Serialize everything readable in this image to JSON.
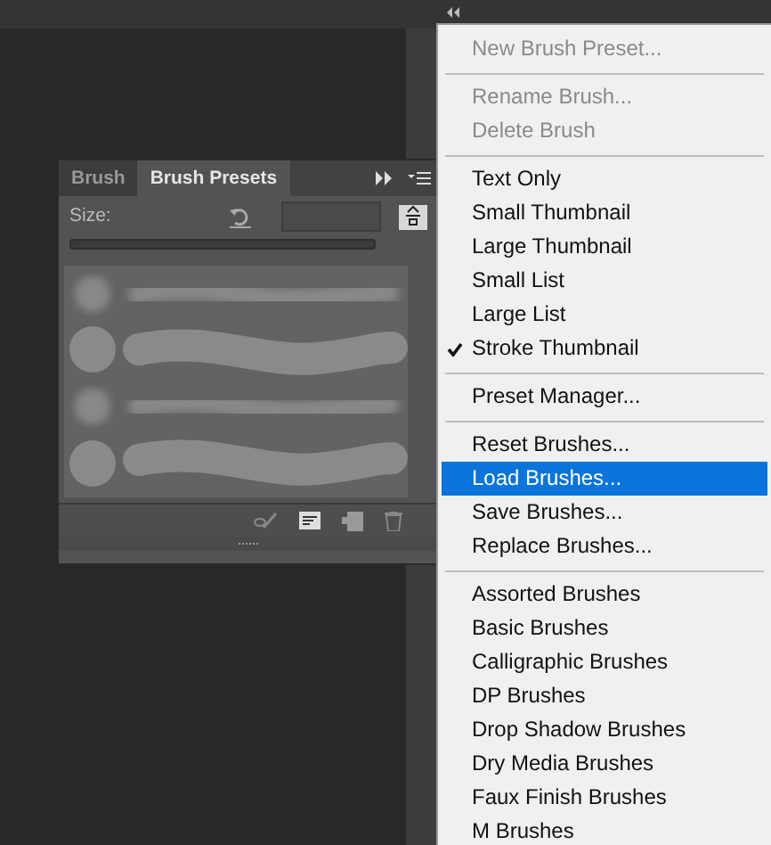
{
  "panel": {
    "tabs": [
      {
        "label": "Brush",
        "selected": false
      },
      {
        "label": "Brush Presets",
        "selected": true
      }
    ],
    "size_label": "Size:"
  },
  "menu": {
    "items": [
      {
        "kind": "item",
        "label": "New Brush Preset...",
        "disabled": true,
        "checked": false,
        "selected": false
      },
      {
        "kind": "separator"
      },
      {
        "kind": "item",
        "label": "Rename Brush...",
        "disabled": true,
        "checked": false,
        "selected": false
      },
      {
        "kind": "item",
        "label": "Delete Brush",
        "disabled": true,
        "checked": false,
        "selected": false
      },
      {
        "kind": "separator"
      },
      {
        "kind": "item",
        "label": "Text Only",
        "disabled": false,
        "checked": false,
        "selected": false
      },
      {
        "kind": "item",
        "label": "Small Thumbnail",
        "disabled": false,
        "checked": false,
        "selected": false
      },
      {
        "kind": "item",
        "label": "Large Thumbnail",
        "disabled": false,
        "checked": false,
        "selected": false
      },
      {
        "kind": "item",
        "label": "Small List",
        "disabled": false,
        "checked": false,
        "selected": false
      },
      {
        "kind": "item",
        "label": "Large List",
        "disabled": false,
        "checked": false,
        "selected": false
      },
      {
        "kind": "item",
        "label": "Stroke Thumbnail",
        "disabled": false,
        "checked": true,
        "selected": false
      },
      {
        "kind": "separator"
      },
      {
        "kind": "item",
        "label": "Preset Manager...",
        "disabled": false,
        "checked": false,
        "selected": false
      },
      {
        "kind": "separator"
      },
      {
        "kind": "item",
        "label": "Reset Brushes...",
        "disabled": false,
        "checked": false,
        "selected": false
      },
      {
        "kind": "item",
        "label": "Load Brushes...",
        "disabled": false,
        "checked": false,
        "selected": true
      },
      {
        "kind": "item",
        "label": "Save Brushes...",
        "disabled": false,
        "checked": false,
        "selected": false
      },
      {
        "kind": "item",
        "label": "Replace Brushes...",
        "disabled": false,
        "checked": false,
        "selected": false
      },
      {
        "kind": "separator"
      },
      {
        "kind": "item",
        "label": "Assorted Brushes",
        "disabled": false,
        "checked": false,
        "selected": false
      },
      {
        "kind": "item",
        "label": "Basic Brushes",
        "disabled": false,
        "checked": false,
        "selected": false
      },
      {
        "kind": "item",
        "label": "Calligraphic Brushes",
        "disabled": false,
        "checked": false,
        "selected": false
      },
      {
        "kind": "item",
        "label": "DP Brushes",
        "disabled": false,
        "checked": false,
        "selected": false
      },
      {
        "kind": "item",
        "label": "Drop Shadow Brushes",
        "disabled": false,
        "checked": false,
        "selected": false
      },
      {
        "kind": "item",
        "label": "Dry Media Brushes",
        "disabled": false,
        "checked": false,
        "selected": false
      },
      {
        "kind": "item",
        "label": "Faux Finish Brushes",
        "disabled": false,
        "checked": false,
        "selected": false
      },
      {
        "kind": "item",
        "label": "M Brushes",
        "disabled": false,
        "checked": false,
        "selected": false
      }
    ]
  }
}
